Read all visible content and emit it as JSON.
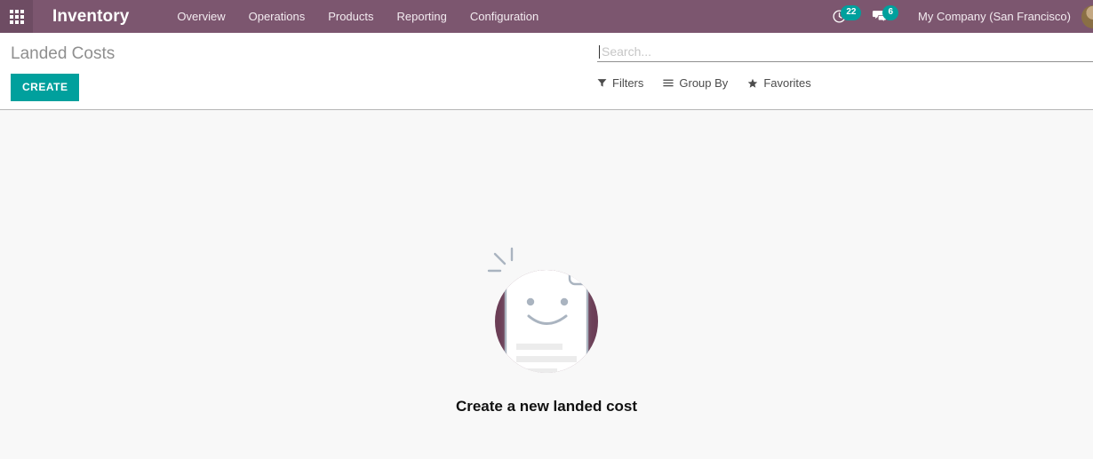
{
  "navbar": {
    "apps_icon": "apps-grid-icon",
    "brand": "Inventory",
    "menu_items": [
      {
        "label": "Overview"
      },
      {
        "label": "Operations"
      },
      {
        "label": "Products"
      },
      {
        "label": "Reporting"
      },
      {
        "label": "Configuration"
      }
    ],
    "systray": {
      "activities": {
        "icon": "clock-icon",
        "count": "22"
      },
      "messages": {
        "icon": "chat-bubble-icon",
        "count": "6"
      },
      "company": "My Company (San Francisco)",
      "avatar": "user-avatar"
    },
    "colors": {
      "background": "#7c566f",
      "apps_block": "#6e4c63",
      "badge": "#00a09d"
    }
  },
  "control_panel": {
    "title": "Landed Costs",
    "create_label": "CREATE",
    "create_color": "#00a09d",
    "search": {
      "placeholder": "Search...",
      "value": ""
    },
    "buttons": [
      {
        "label": "Filters",
        "icon": "funnel-icon"
      },
      {
        "label": "Group By",
        "icon": "hamburger-lines-icon"
      },
      {
        "label": "Favorites",
        "icon": "star-icon"
      }
    ]
  },
  "content": {
    "empty_state": {
      "caption": "Create a new landed cost",
      "illustration": "smiling-document-icon",
      "circle_color": "#6b3e56",
      "document_border_color": "#aab4c0",
      "document_fill": "#ffffff",
      "placeholder_line_color": "#ececec"
    }
  }
}
